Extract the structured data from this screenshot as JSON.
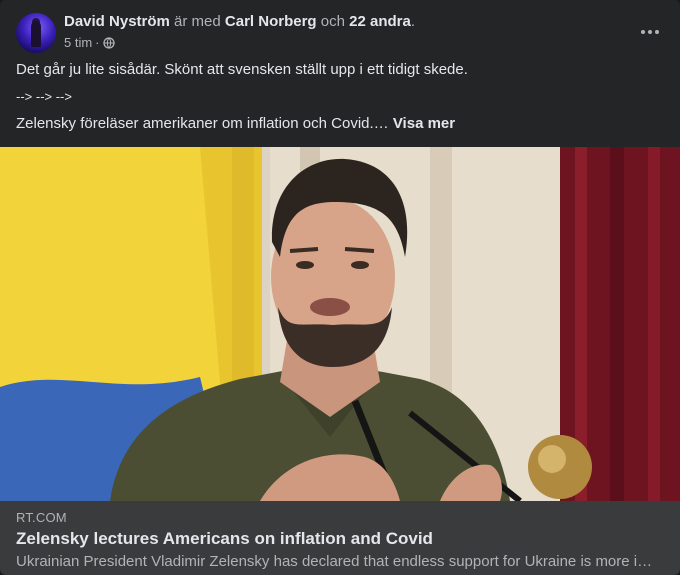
{
  "post": {
    "author": "David Nyström",
    "with_text": "är med",
    "tagged": "Carl Norberg",
    "and_text": "och",
    "others": "22 andra",
    "end_punct": ".",
    "time": "5 tim",
    "sep": "·",
    "privacy_icon": "globe-icon",
    "menu_icon": "more-options-icon",
    "lines": [
      "Det går ju lite sisådär. Skönt att svensken ställt upp i ett tidigt skede.",
      "--> --> -->",
      "Zelensky föreläser amerikaner om inflation och Covid.…"
    ],
    "see_more": "Visa mer"
  },
  "link": {
    "domain": "RT.COM",
    "title": "Zelensky lectures Americans on inflation and Covid",
    "description": "Ukrainian President Vladimir Zelensky has declared that endless support for Ukraine is more important than inflation and Covid"
  },
  "colors": {
    "card_bg": "#242526",
    "link_bg": "#3a3b3c",
    "text_primary": "#e4e6eb",
    "text_secondary": "#b0b3b8",
    "flag_yellow": "#f2d33a",
    "flag_blue": "#3a67b8",
    "curtain": "#7a1520",
    "shirt": "#4b4e32"
  }
}
